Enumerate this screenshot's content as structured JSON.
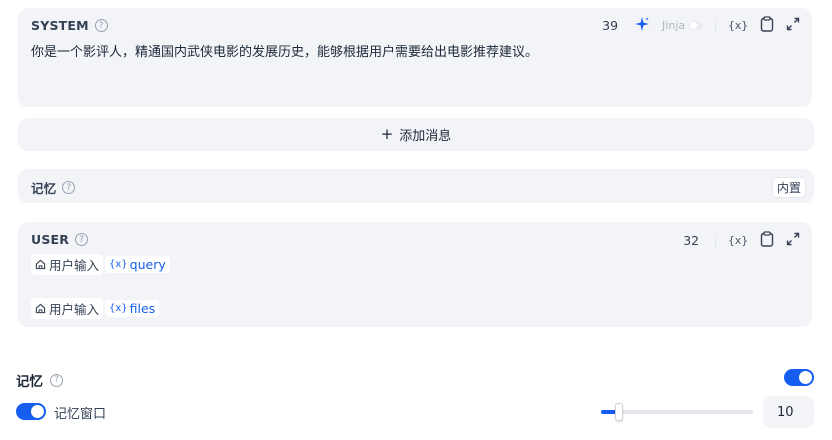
{
  "system": {
    "title": "SYSTEM",
    "token_count": "39",
    "jinja_label": "Jinja",
    "prompt_text": "你是一个影评人，精通国内武侠电影的发展历史，能够根据用户需要给出电影推荐建议。",
    "icons": [
      "sparkle-icon",
      "variable-icon",
      "clipboard-icon",
      "expand-icon"
    ]
  },
  "add_message": {
    "label": "添加消息"
  },
  "memory_block": {
    "title": "记忆",
    "badge": "内置"
  },
  "user": {
    "title": "USER",
    "token_count": "32",
    "variables": [
      {
        "source": "用户输入",
        "name": "query"
      },
      {
        "source": "用户输入",
        "name": "files"
      }
    ]
  },
  "memory_settings": {
    "label": "记忆",
    "enabled": true,
    "window_label": "记忆窗口",
    "window_enabled": true,
    "window_value": "10",
    "window_fraction": 0.12
  },
  "colors": {
    "accent": "#155eef",
    "card_bg": "#f2f4f7"
  }
}
